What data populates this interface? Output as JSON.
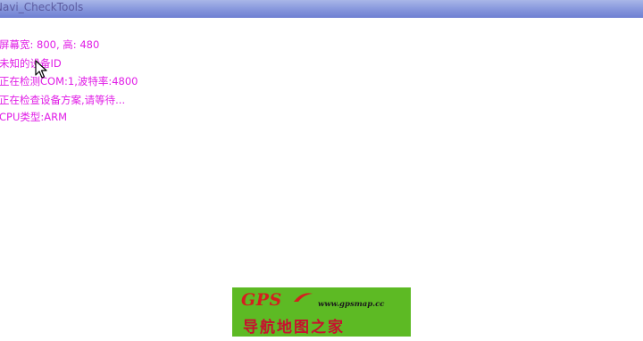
{
  "window": {
    "title": "Navi_CheckTools"
  },
  "log_lines": [
    "屏幕宽: 800, 高: 480",
    "未知的设备ID",
    "正在检测COM:1,波特率:4800",
    "正在检查设备方案,请等待...",
    "CPU类型:ARM"
  ],
  "watermark": {
    "logo": "GPS",
    "url": "www.gpsmap.cc",
    "name": "导航地图之家"
  },
  "colors": {
    "log_text": "#e01ce6",
    "titlebar": "#8595dc",
    "banner_bg": "#5dba24"
  }
}
